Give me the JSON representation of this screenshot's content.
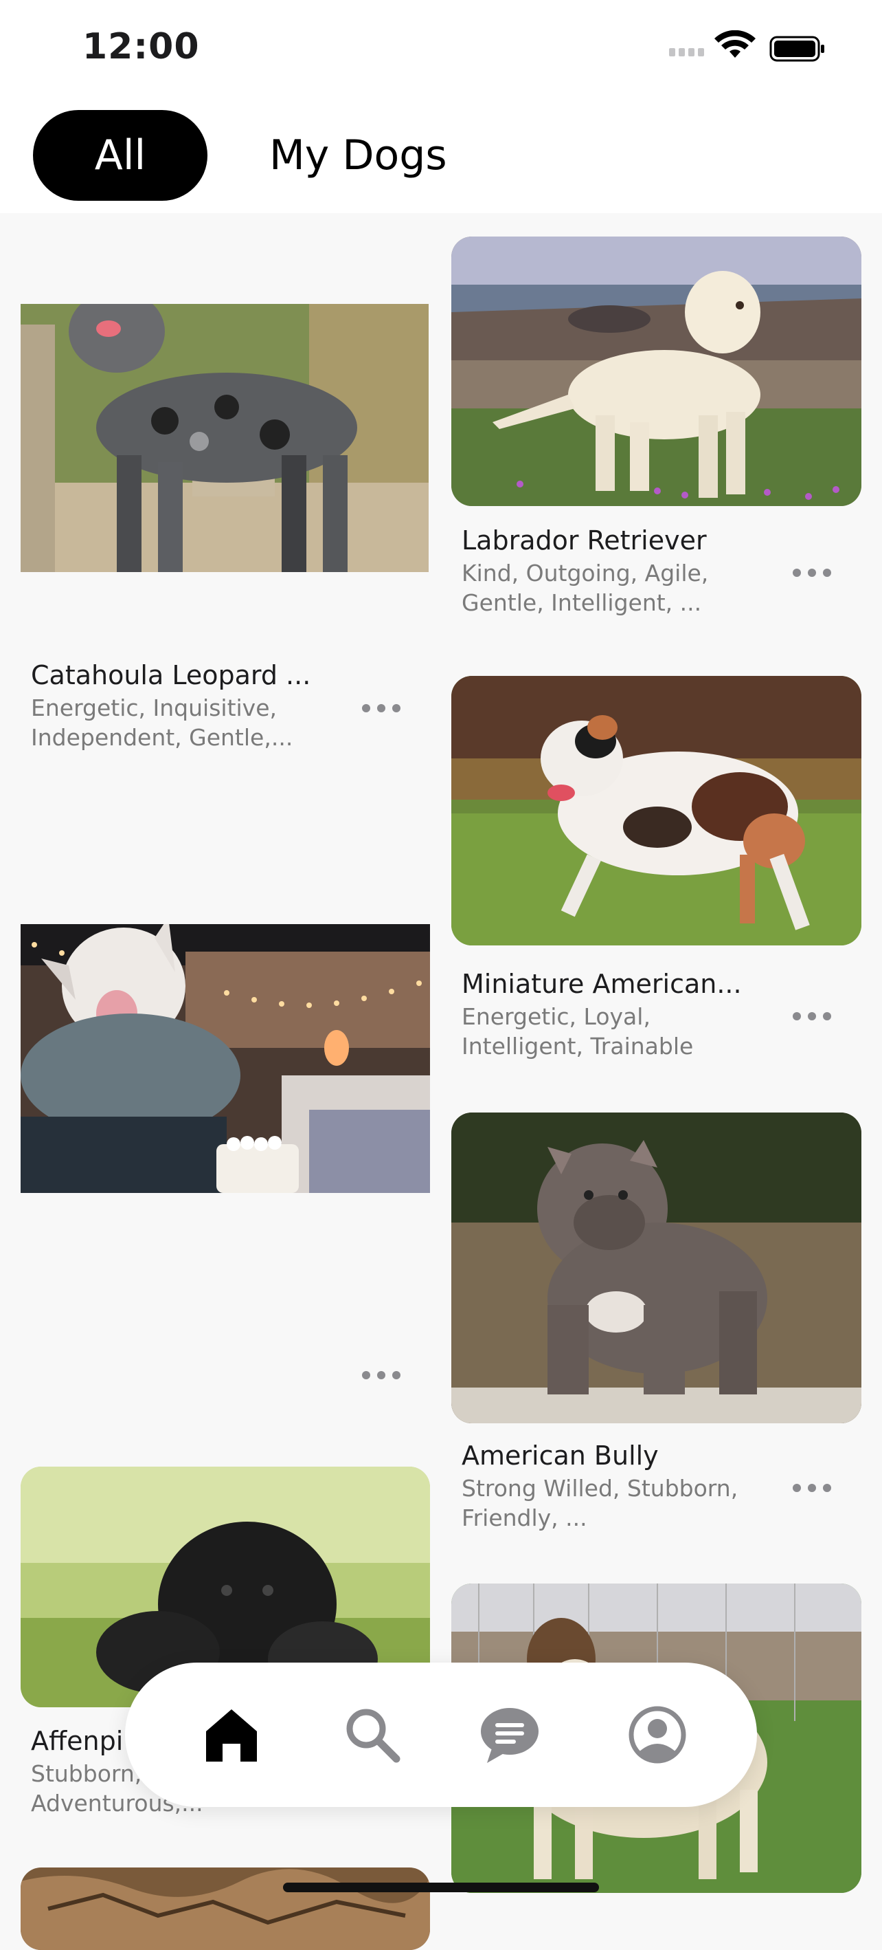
{
  "status_bar": {
    "time": "12:00",
    "icons": [
      "signal-icon",
      "wifi-icon",
      "battery-icon"
    ]
  },
  "tabs": [
    {
      "label": "All",
      "selected": true
    },
    {
      "label": "My Dogs",
      "selected": false
    }
  ],
  "cards": [
    {
      "id": "catahoula",
      "title": "Catahoula Leopard ...",
      "traits": "Energetic, Inquisitive, Independent, Gentle,..."
    },
    {
      "id": "labrador",
      "title": "Labrador Retriever",
      "traits": "Kind, Outgoing, Agile, Gentle, Intelligent, ..."
    },
    {
      "id": "miniature",
      "title": "Miniature American...",
      "traits": "Energetic, Loyal, Intelligent, Trainable"
    },
    {
      "id": "bully",
      "title": "American Bully",
      "traits": "Strong Willed, Stubborn, Friendly, ..."
    },
    {
      "id": "affenpinscher",
      "title": "Affenpi",
      "traits": "Stubborn, Playful, Adventurous,..."
    }
  ],
  "bottom_nav": [
    {
      "icon": "home-icon",
      "active": true
    },
    {
      "icon": "search-icon",
      "active": false
    },
    {
      "icon": "chat-icon",
      "active": false
    },
    {
      "icon": "profile-icon",
      "active": false
    }
  ],
  "colors": {
    "background": "#f8f8f8",
    "tab_active_bg": "#000000",
    "nav_active": "#000000",
    "nav_inactive": "#8a8a8e",
    "subtitle": "#7a7a7a"
  }
}
